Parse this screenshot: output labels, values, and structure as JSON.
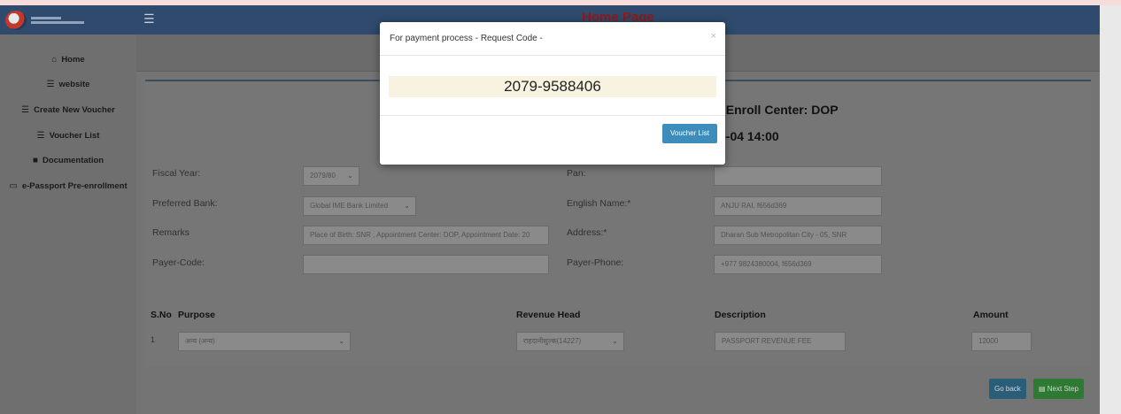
{
  "header": {
    "title": "Home Page",
    "menu_icon": "hamburger-icon"
  },
  "sidebar": {
    "items": [
      {
        "label": "Home",
        "icon": "home-icon",
        "glyph": "⌂"
      },
      {
        "label": "website",
        "icon": "list-icon",
        "glyph": "☰"
      },
      {
        "label": "Create New Voucher",
        "icon": "list-icon",
        "glyph": "☰"
      },
      {
        "label": "Voucher List",
        "icon": "list-icon",
        "glyph": "☰"
      },
      {
        "label": "Documentation",
        "icon": "book-icon",
        "glyph": "■"
      },
      {
        "label": "e-Passport Pre-enrollment",
        "icon": "laptop-icon",
        "glyph": "▭"
      }
    ]
  },
  "form": {
    "heading_center": ", Enroll Center: DOP",
    "heading_time": "5-04 14:00",
    "fiscal_year": {
      "label": "Fiscal Year:",
      "value": "2079/80"
    },
    "preferred_bank": {
      "label": "Preferred Bank:",
      "value": "Global IME Bank Limited"
    },
    "remarks": {
      "label": "Remarks",
      "value": "Place of Birth: SNR , Appointment Center: DOP, Appointment Date: 20"
    },
    "payer_code": {
      "label": "Payer-Code:",
      "value": ""
    },
    "pan": {
      "label": "Pan:",
      "value": ""
    },
    "english_name": {
      "label": "English Name:*",
      "value": "ANJU RAI, f656d369"
    },
    "address": {
      "label": "Address:*",
      "value": "Dharan Sub Metropolitan City - 05, SNR"
    },
    "payer_phone": {
      "label": "Payer-Phone:",
      "value": "+977 9824380004, f656d369"
    }
  },
  "table": {
    "headers": [
      "S.No",
      "Purpose",
      "Revenue Head",
      "Description",
      "Amount"
    ],
    "rows": [
      {
        "sno": "1",
        "purpose": "अन्य (अन्य)",
        "revenue_head": "राहदानीशुल्क(14227)",
        "description": "PASSPORT REVENUE FEE",
        "amount": "12000"
      }
    ]
  },
  "buttons": {
    "go_back": "Go back",
    "next_step": "Next Step",
    "next_icon": "credit-card-icon"
  },
  "modal": {
    "title": "For payment process - Request Code -",
    "close": "×",
    "code": "2079-9588406",
    "voucher_list": "Voucher List"
  }
}
